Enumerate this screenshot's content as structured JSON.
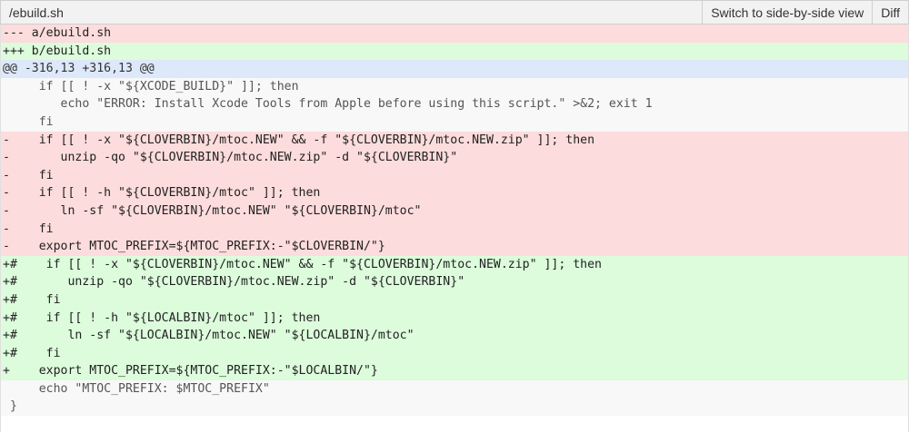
{
  "header": {
    "file_path": "/ebuild.sh",
    "switch_view_label": "Switch to side-by-side view",
    "diff_label": "Diff"
  },
  "lines": [
    {
      "type": "hdr-del",
      "text": "--- a/ebuild.sh"
    },
    {
      "type": "hdr-add",
      "text": "+++ b/ebuild.sh"
    },
    {
      "type": "hunk",
      "text": "@@ -316,13 +316,13 @@"
    },
    {
      "type": "ctx",
      "text": "     if [[ ! -x \"${XCODE_BUILD}\" ]]; then"
    },
    {
      "type": "ctx",
      "text": "        echo \"ERROR: Install Xcode Tools from Apple before using this script.\" >&2; exit 1"
    },
    {
      "type": "ctx",
      "text": "     fi"
    },
    {
      "type": "del",
      "text": "-    if [[ ! -x \"${CLOVERBIN}/mtoc.NEW\" && -f \"${CLOVERBIN}/mtoc.NEW.zip\" ]]; then"
    },
    {
      "type": "del",
      "text": "-       unzip -qo \"${CLOVERBIN}/mtoc.NEW.zip\" -d \"${CLOVERBIN}\""
    },
    {
      "type": "del",
      "text": "-    fi"
    },
    {
      "type": "del",
      "text": "-    if [[ ! -h \"${CLOVERBIN}/mtoc\" ]]; then"
    },
    {
      "type": "del",
      "text": "-       ln -sf \"${CLOVERBIN}/mtoc.NEW\" \"${CLOVERBIN}/mtoc\""
    },
    {
      "type": "del",
      "text": "-    fi"
    },
    {
      "type": "del",
      "text": "-    export MTOC_PREFIX=${MTOC_PREFIX:-\"$CLOVERBIN/\"}"
    },
    {
      "type": "add",
      "text": "+#    if [[ ! -x \"${CLOVERBIN}/mtoc.NEW\" && -f \"${CLOVERBIN}/mtoc.NEW.zip\" ]]; then"
    },
    {
      "type": "add",
      "text": "+#       unzip -qo \"${CLOVERBIN}/mtoc.NEW.zip\" -d \"${CLOVERBIN}\""
    },
    {
      "type": "add",
      "text": "+#    fi"
    },
    {
      "type": "add",
      "text": "+#    if [[ ! -h \"${LOCALBIN}/mtoc\" ]]; then"
    },
    {
      "type": "add",
      "text": "+#       ln -sf \"${LOCALBIN}/mtoc.NEW\" \"${LOCALBIN}/mtoc\""
    },
    {
      "type": "add",
      "text": "+#    fi"
    },
    {
      "type": "add",
      "text": "+    export MTOC_PREFIX=${MTOC_PREFIX:-\"$LOCALBIN/\"}"
    },
    {
      "type": "ctx",
      "text": "     echo \"MTOC_PREFIX: $MTOC_PREFIX\""
    },
    {
      "type": "ctx",
      "text": " }"
    }
  ]
}
